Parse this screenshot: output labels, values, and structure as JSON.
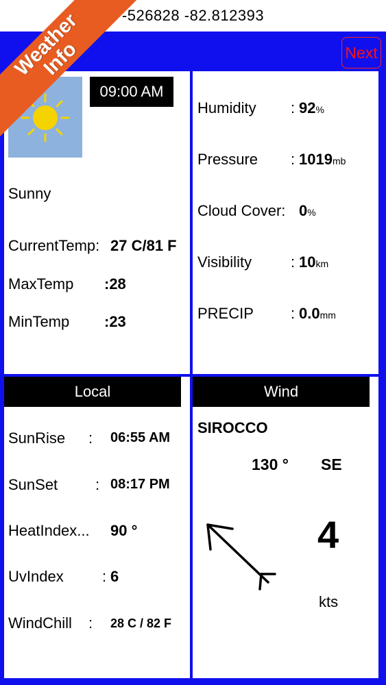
{
  "coords": {
    "text": "-526828 -82.812393"
  },
  "nav": {
    "next_label": "Next"
  },
  "ribbon": {
    "line1": "Weather",
    "line2": "Info"
  },
  "weather": {
    "time": "09:00 AM",
    "condition": "Sunny",
    "icon": "sun-icon",
    "rows": [
      {
        "label": "CurrentTemp:",
        "value": "27 C/81 F"
      },
      {
        "label": "MaxTemp",
        "value": ":28"
      },
      {
        "label": "MinTemp",
        "value": ":23"
      }
    ]
  },
  "details": [
    {
      "label": "Humidity",
      "sep": ":",
      "value": "92",
      "unit": "%"
    },
    {
      "label": "Pressure",
      "sep": ":",
      "value": "1019",
      "unit": "mb"
    },
    {
      "label": "Cloud Cover:",
      "sep": "",
      "value": "0",
      "unit": "%"
    },
    {
      "label": "Visibility",
      "sep": ":",
      "value": "10",
      "unit": "km"
    },
    {
      "label": "PRECIP",
      "sep": ":",
      "value": "0.0",
      "unit": "mm"
    }
  ],
  "local": {
    "title": "Local",
    "rows": [
      {
        "label": "SunRise",
        "sep": ":",
        "value": "06:55 AM"
      },
      {
        "label": "SunSet",
        "sep": ":",
        "value": "08:17 PM"
      },
      {
        "label": "HeatIndex...",
        "sep": "",
        "value": "90 °"
      },
      {
        "label": "UvIndex",
        "sep": ":",
        "value": "6"
      },
      {
        "label": "WindChill",
        "sep": ":",
        "value": "28 C / 82 F"
      }
    ]
  },
  "wind": {
    "title": "Wind",
    "name": "SIROCCO",
    "degrees": "130 °",
    "direction": "SE",
    "speed": "4",
    "unit": "kts",
    "icon": "wind-arrow-icon"
  },
  "colors": {
    "frame": "#1010ee",
    "ribbon": "#e85c22",
    "next": "#ff1010",
    "sky": "#8eb2de",
    "sun": "#f5d300"
  }
}
